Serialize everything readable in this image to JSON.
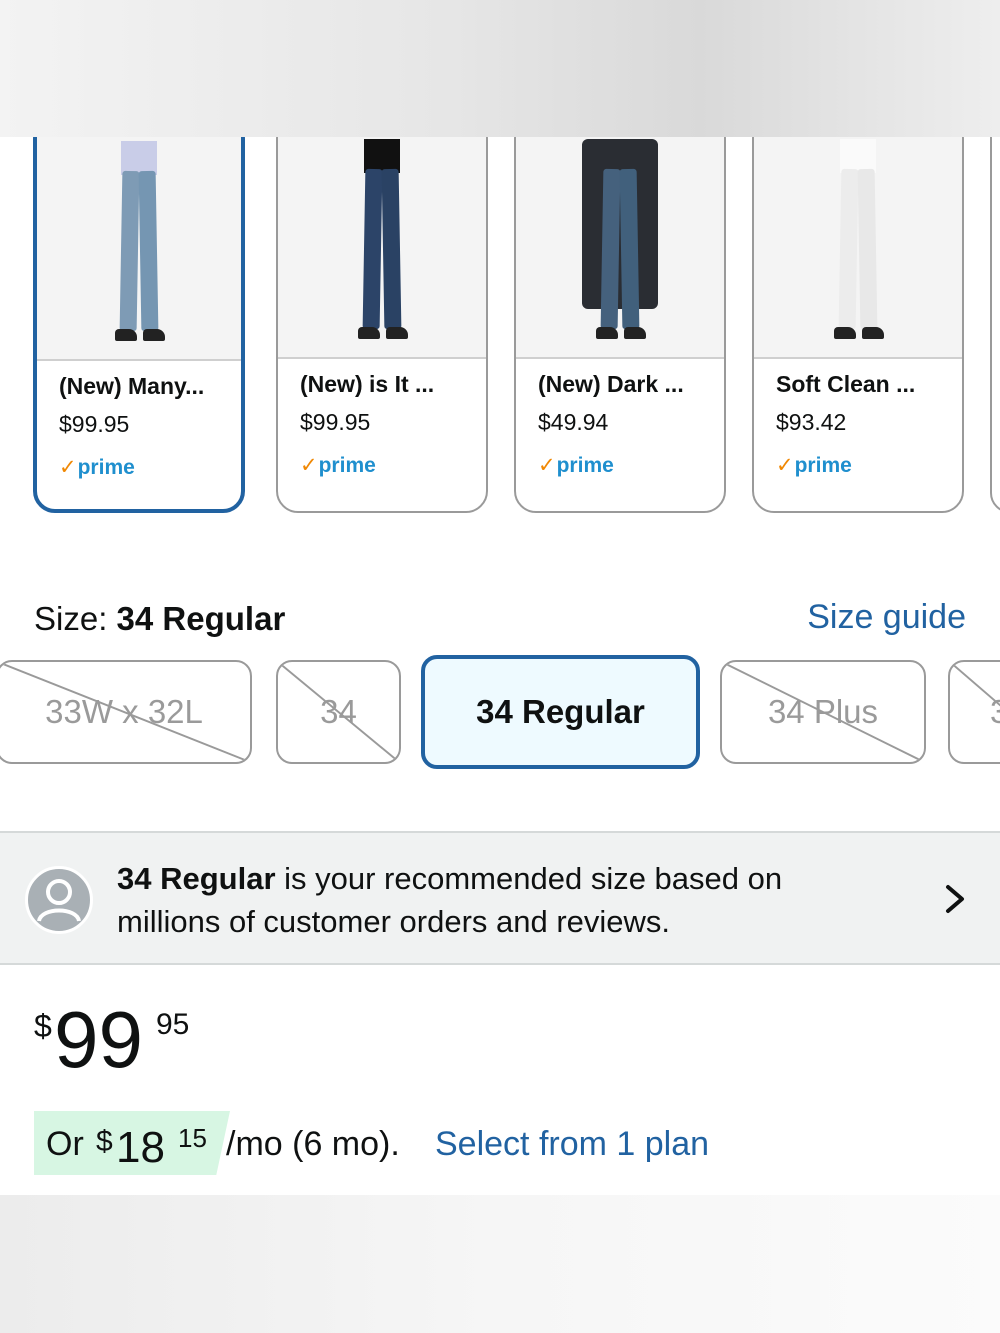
{
  "swatches": [
    {
      "title": "(New) Many...",
      "price": "$99.95",
      "prime": "prime",
      "selected": true
    },
    {
      "title": "(New) is It ...",
      "price": "$99.95",
      "prime": "prime",
      "selected": false
    },
    {
      "title": "(New) Dark ...",
      "price": "$49.94",
      "prime": "prime",
      "selected": false
    },
    {
      "title": "Soft Clean ...",
      "price": "$93.42",
      "prime": "prime",
      "selected": false
    }
  ],
  "size": {
    "label": "Size:",
    "selected_value": "34 Regular",
    "guide_link": "Size guide",
    "options": [
      "33W x 32L",
      "34",
      "34 Regular",
      "34 Plus",
      "3"
    ]
  },
  "recommendation": {
    "size": "34 Regular",
    "text": " is your recommended size based on millions of customer orders and reviews."
  },
  "price": {
    "currency": "$",
    "whole": "99",
    "fraction": "95"
  },
  "installment": {
    "prefix": "Or",
    "currency": "$",
    "whole": "18",
    "fraction": "15",
    "term": "/mo (6 mo).",
    "link": "Select from 1 plan"
  },
  "colors": {
    "accent": "#2162a1",
    "prime_blue": "#1f8fce",
    "prime_check": "#f08804",
    "installment_highlight": "#d7f6e3",
    "banner_bg": "#f0f2f2"
  }
}
